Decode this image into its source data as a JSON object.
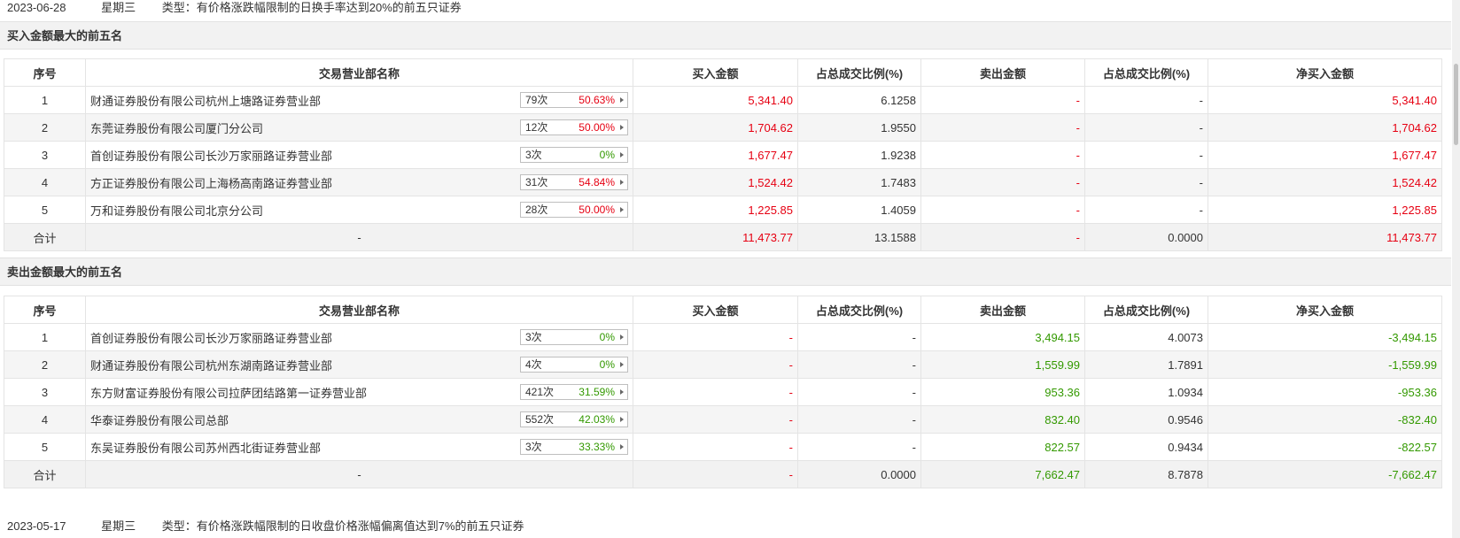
{
  "day1": {
    "date": "2023-06-28",
    "weekday": "星期三",
    "type": "类型：有价格涨跌幅限制的日换手率达到20%的前五只证券"
  },
  "day2": {
    "date": "2023-05-17",
    "weekday": "星期三",
    "type": "类型：有价格涨跌幅限制的日收盘价格涨幅偏离值达到7%的前五只证券"
  },
  "columns": [
    "序号",
    "交易营业部名称",
    "买入金额",
    "占总成交比例(%)",
    "卖出金额",
    "占总成交比例(%)",
    "净买入金额"
  ],
  "buy_section": {
    "title": "买入金额最大的前五名",
    "rows": [
      {
        "no": "1",
        "name": "财通证券股份有限公司杭州上塘路证券营业部",
        "count": "79次",
        "pct": "50.63%",
        "buy": "5,341.40",
        "buy_ratio": "6.1258",
        "sell": "-",
        "sell_ratio": "-",
        "net": "5,341.40"
      },
      {
        "no": "2",
        "name": "东莞证券股份有限公司厦门分公司",
        "count": "12次",
        "pct": "50.00%",
        "buy": "1,704.62",
        "buy_ratio": "1.9550",
        "sell": "-",
        "sell_ratio": "-",
        "net": "1,704.62"
      },
      {
        "no": "3",
        "name": "首创证券股份有限公司长沙万家丽路证券营业部",
        "count": "3次",
        "pct": "0%",
        "buy": "1,677.47",
        "buy_ratio": "1.9238",
        "sell": "-",
        "sell_ratio": "-",
        "net": "1,677.47"
      },
      {
        "no": "4",
        "name": "方正证券股份有限公司上海杨高南路证券营业部",
        "count": "31次",
        "pct": "54.84%",
        "buy": "1,524.42",
        "buy_ratio": "1.7483",
        "sell": "-",
        "sell_ratio": "-",
        "net": "1,524.42"
      },
      {
        "no": "5",
        "name": "万和证券股份有限公司北京分公司",
        "count": "28次",
        "pct": "50.00%",
        "buy": "1,225.85",
        "buy_ratio": "1.4059",
        "sell": "-",
        "sell_ratio": "-",
        "net": "1,225.85"
      }
    ],
    "total": {
      "label": "合计",
      "name": "-",
      "buy": "11,473.77",
      "buy_ratio": "13.1588",
      "sell": "-",
      "sell_ratio": "0.0000",
      "net": "11,473.77"
    }
  },
  "sell_section": {
    "title": "卖出金额最大的前五名",
    "rows": [
      {
        "no": "1",
        "name": "首创证券股份有限公司长沙万家丽路证券营业部",
        "count": "3次",
        "pct": "0%",
        "buy": "-",
        "buy_ratio": "-",
        "sell": "3,494.15",
        "sell_ratio": "4.0073",
        "net": "-3,494.15"
      },
      {
        "no": "2",
        "name": "财通证券股份有限公司杭州东湖南路证券营业部",
        "count": "4次",
        "pct": "0%",
        "buy": "-",
        "buy_ratio": "-",
        "sell": "1,559.99",
        "sell_ratio": "1.7891",
        "net": "-1,559.99"
      },
      {
        "no": "3",
        "name": "东方财富证券股份有限公司拉萨团结路第一证券营业部",
        "count": "421次",
        "pct": "31.59%",
        "buy": "-",
        "buy_ratio": "-",
        "sell": "953.36",
        "sell_ratio": "1.0934",
        "net": "-953.36"
      },
      {
        "no": "4",
        "name": "华泰证券股份有限公司总部",
        "count": "552次",
        "pct": "42.03%",
        "buy": "-",
        "buy_ratio": "-",
        "sell": "832.40",
        "sell_ratio": "0.9546",
        "net": "-832.40"
      },
      {
        "no": "5",
        "name": "东吴证券股份有限公司苏州西北街证券营业部",
        "count": "3次",
        "pct": "33.33%",
        "buy": "-",
        "buy_ratio": "-",
        "sell": "822.57",
        "sell_ratio": "0.9434",
        "net": "-822.57"
      }
    ],
    "total": {
      "label": "合计",
      "name": "-",
      "buy": "-",
      "buy_ratio": "0.0000",
      "sell": "7,662.47",
      "sell_ratio": "8.7878",
      "net": "-7,662.47"
    }
  },
  "colors": {
    "up": "#e60012",
    "down": "#339900",
    "header_bg": "#f2f2f2",
    "border": "#e4e4e4"
  },
  "icons": {
    "badge_arrow": "caret-right-icon"
  }
}
